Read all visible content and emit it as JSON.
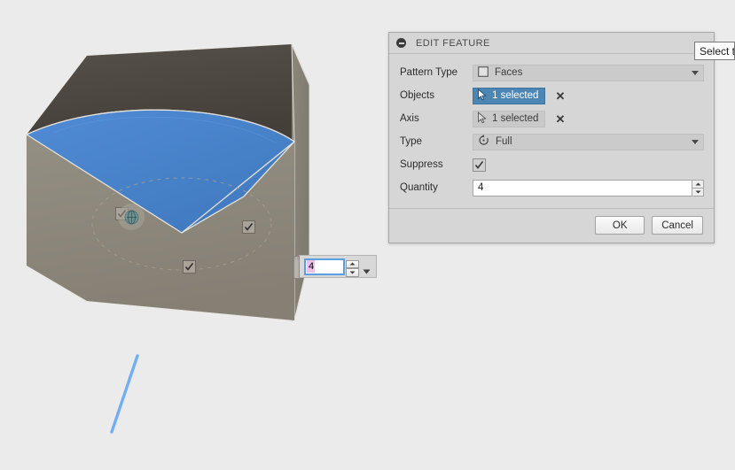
{
  "viewport": {
    "name": "3d-modeling-viewport",
    "background_color": "#ebebeb",
    "model": {
      "name": "box-with-conical-cut",
      "top_face_color": "#4d4840",
      "front_face_color": "#8d887c",
      "right_face_color": "#8a8579",
      "cut_face_color": "#4a86cc",
      "edge_color": "#e8e4dc"
    },
    "axis_line": {
      "name": "selected-axis-line",
      "color": "#74aef0"
    },
    "pattern_markers": [
      {
        "name": "pattern-instance-checkbox-1",
        "checked": true
      },
      {
        "name": "pattern-instance-checkbox-2",
        "checked": true
      },
      {
        "name": "pattern-instance-checkbox-3",
        "checked": true
      }
    ],
    "rotation_handle_icon": "rotate-handle-icon",
    "canvas_quantity": {
      "value": "4",
      "increment_icon": "spinner-up-icon",
      "decrement_icon": "spinner-down-icon",
      "dropdown_icon": "chevron-down-icon"
    }
  },
  "dialog": {
    "title": "EDIT FEATURE",
    "collapse_icon": "collapse-minus-icon",
    "rows": {
      "pattern_type": {
        "label": "Pattern Type",
        "value": "Faces",
        "icon": "faces-square-icon",
        "dropdown_icon": "chevron-down-icon"
      },
      "objects": {
        "label": "Objects",
        "value": "1 selected",
        "icon": "selection-cursor-icon",
        "clear_icon": "clear-x-icon",
        "active": true
      },
      "axis": {
        "label": "Axis",
        "value": "1 selected",
        "icon": "selection-cursor-icon",
        "clear_icon": "clear-x-icon",
        "active": false
      },
      "type": {
        "label": "Type",
        "value": "Full",
        "icon": "rotation-full-icon",
        "dropdown_icon": "chevron-down-icon"
      },
      "suppress": {
        "label": "Suppress",
        "checked": true,
        "icon": "checkbox-checked-icon"
      },
      "quantity": {
        "label": "Quantity",
        "value": "4",
        "increment_icon": "spinner-up-icon",
        "decrement_icon": "spinner-down-icon"
      }
    },
    "buttons": {
      "ok": "OK",
      "cancel": "Cancel"
    },
    "accent_color": "#4b86b4"
  },
  "tooltip": {
    "text": "Select t"
  }
}
